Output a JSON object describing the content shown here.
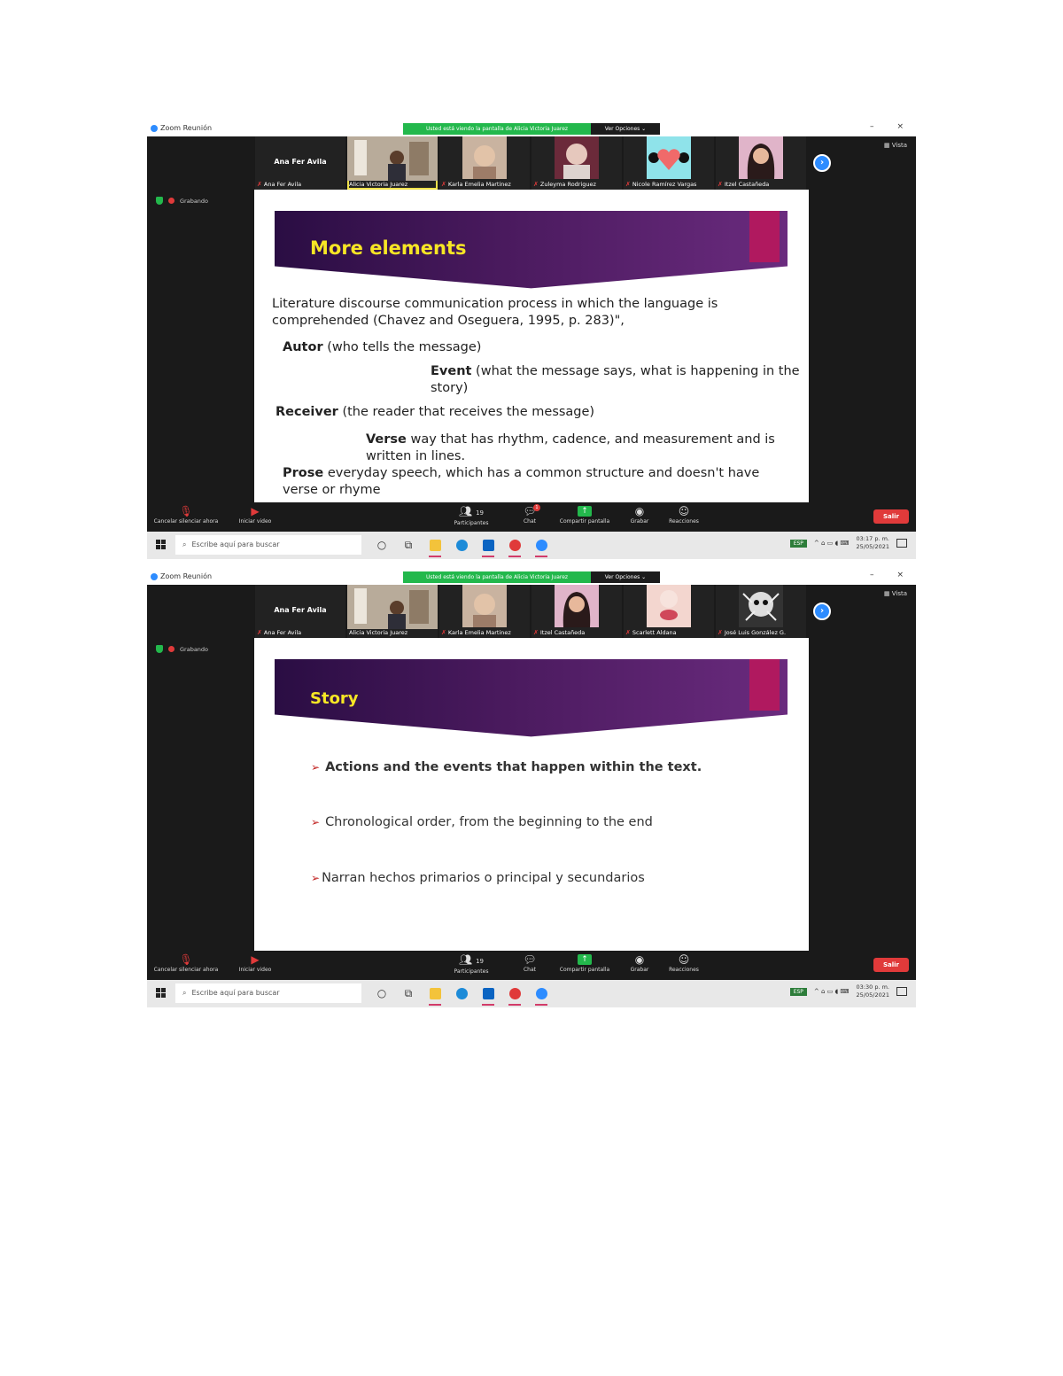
{
  "screenshots": [
    {
      "window_title": "Zoom Reunión",
      "share_banner": "Usted está viendo la pantalla de Alicia Victoria Juarez",
      "view_options": "Ver Opciones ⌄",
      "window_controls": [
        "–",
        "×"
      ],
      "vista_label": "Vista",
      "recording_label": "Grabando",
      "participants": [
        {
          "name": "Ana Fer Avila",
          "display": "Ana Fer Avila",
          "video": false,
          "muted": true
        },
        {
          "name": "Alicia Victoria Juarez",
          "video": true,
          "muted": false,
          "active": true
        },
        {
          "name": "Karla Emelia Martinez",
          "video": true,
          "muted": true
        },
        {
          "name": "Zuleyma Rodriguez",
          "video": true,
          "muted": true
        },
        {
          "name": "Nicole Ramírez Vargas",
          "video": true,
          "muted": true
        },
        {
          "name": "Itzel Castañeda",
          "video": true,
          "muted": true
        }
      ],
      "slide": {
        "title": "More elements",
        "paragraph": "Literature discourse communication process in which the language is comprehended (Chavez and Oseguera, 1995, p. 283)\",",
        "items": [
          {
            "term": "Autor",
            "text": " (who tells the message)"
          },
          {
            "term": "Event",
            "text": " (what the message says, what is happening in the story)"
          },
          {
            "term": "Receiver",
            "text": " (the reader that receives the message)"
          },
          {
            "term": "Verse",
            "text": " way that has rhythm, cadence, and measurement and is written in lines."
          },
          {
            "term": "Prose",
            "text": " everyday speech, which has a common structure and doesn't have verse or rhyme"
          }
        ]
      },
      "toolbar": {
        "mic": "Cancelar silenciar ahora",
        "video": "Iniciar video",
        "participants": "Participantes",
        "participants_count": "19",
        "chat": "Chat",
        "chat_badge": "1",
        "share": "Compartir pantalla",
        "record": "Grabar",
        "reactions": "Reacciones",
        "leave": "Salir"
      },
      "taskbar": {
        "search_placeholder": "Escribe aquí para buscar",
        "lang_badge": "ESP",
        "time": "03:17 p. m.",
        "date": "25/05/2021"
      }
    },
    {
      "window_title": "Zoom Reunión",
      "share_banner": "Usted está viendo la pantalla de Alicia Victoria Juarez",
      "view_options": "Ver Opciones ⌄",
      "window_controls": [
        "–",
        "×"
      ],
      "vista_label": "Vista",
      "recording_label": "Grabando",
      "participants": [
        {
          "name": "Ana Fer Avila",
          "display": "Ana Fer Avila",
          "video": false,
          "muted": true
        },
        {
          "name": "Alicia Victoria Juarez",
          "video": true,
          "muted": false
        },
        {
          "name": "Karla Emelia Martinez",
          "video": true,
          "muted": true
        },
        {
          "name": "Itzel Castañeda",
          "video": true,
          "muted": true
        },
        {
          "name": "Scarlett Aldana",
          "video": true,
          "muted": true
        },
        {
          "name": "José Luis González G.",
          "video": true,
          "muted": true
        }
      ],
      "slide": {
        "title": "Story",
        "bullets": [
          "Actions and the events that happen within the text.",
          "Chronological order, from the beginning to the end",
          "Narran hechos primarios o principal y secundarios"
        ]
      },
      "toolbar": {
        "mic": "Cancelar silenciar ahora",
        "video": "Iniciar video",
        "participants": "Participantes",
        "participants_count": "19",
        "chat": "Chat",
        "chat_badge": "",
        "share": "Compartir pantalla",
        "record": "Grabar",
        "reactions": "Reacciones",
        "leave": "Salir"
      },
      "taskbar": {
        "search_placeholder": "Escribe aquí para buscar",
        "lang_badge": "ESP",
        "time": "03:30 p. m.",
        "date": "25/05/2021"
      }
    }
  ],
  "colors": {
    "zoom_blue": "#2d8cff",
    "share_green": "#23b84c",
    "leave_red": "#e03a3a",
    "slide_title_yellow": "#f7e625",
    "slide_purple": "#4a1a5e",
    "slide_magenta": "#b0195f"
  },
  "icons": [
    "zoom-logo-icon",
    "shield-icon",
    "record-dot-icon",
    "mic-off-icon",
    "video-off-icon",
    "participants-icon",
    "chat-icon",
    "share-screen-icon",
    "record-icon",
    "reactions-icon",
    "next-page-icon",
    "windows-start-icon",
    "search-icon",
    "task-view-icon",
    "file-explorer-icon",
    "edge-icon",
    "outlook-icon",
    "word-icon",
    "chrome-icon",
    "zoom-taskbar-icon",
    "notification-icon"
  ]
}
